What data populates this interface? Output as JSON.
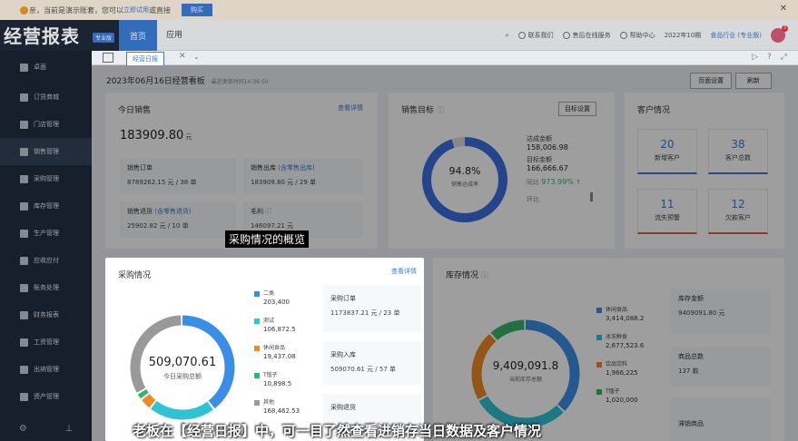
{
  "notice": {
    "text": "亲，当前是演示账套，您可以",
    "link": "立即试用",
    "text2": "或直接",
    "buy": "购买"
  },
  "header": {
    "logo": "经营报表",
    "badge": "专业版",
    "nav_home": "首页",
    "nav_app": "应用",
    "contact": "联系我们",
    "service": "售后在线服务",
    "help": "帮助中心",
    "period": "2022年10期",
    "industry": "食品行业 (专业版)",
    "avatar_badge": "3"
  },
  "sidebar": {
    "items": [
      {
        "label": "卓面"
      },
      {
        "label": "订货商城"
      },
      {
        "label": "门店管理"
      },
      {
        "label": "销售管理"
      },
      {
        "label": "采购管理"
      },
      {
        "label": "库存管理"
      },
      {
        "label": "生产管理"
      },
      {
        "label": "应收应付"
      },
      {
        "label": "账务处理"
      },
      {
        "label": "财务报表"
      },
      {
        "label": "工资管理"
      },
      {
        "label": "出纳管理"
      },
      {
        "label": "资产管理"
      }
    ]
  },
  "tabs": {
    "active": "经营日报"
  },
  "board": {
    "title": "2023年06月16日经营看板",
    "updated": "最近更新时间14:36:50",
    "config_btn": "页面设置",
    "refresh_btn": "刷新"
  },
  "today_sales": {
    "title": "今日销售",
    "detail_link": "查看详情",
    "total": "183909.80",
    "unit": "元",
    "boxes": [
      {
        "label": "销售订单",
        "value": "8789262.15 元 / 38 单"
      },
      {
        "label": "销售出库",
        "link": "(含零售出库)",
        "value": "183909.80 元 / 29 单"
      },
      {
        "label": "销售退货",
        "link": "(含零售退货)",
        "value": "25902.82 元 / 10 单"
      },
      {
        "label": "毛利",
        "value": "146097.21 元"
      }
    ]
  },
  "sales_target": {
    "title": "销售目标",
    "set_btn": "目标设置",
    "percent": "94.8%",
    "center_label": "销售达成率",
    "achieved_label": "达成金额",
    "achieved": "158,006.98",
    "target_label": "目标金额",
    "target": "166,666.67",
    "yoy_label": "同比",
    "yoy": "973.99%",
    "mom_label": "环比"
  },
  "customers": {
    "title": "客户情况",
    "boxes": [
      {
        "n": "20",
        "label": "新增客户"
      },
      {
        "n": "38",
        "label": "客户总数"
      },
      {
        "n": "11",
        "label": "流失预警"
      },
      {
        "n": "12",
        "label": "欠款客户"
      }
    ]
  },
  "purchase": {
    "title": "采购情况",
    "detail_link": "查看详情",
    "total": "509,070.61",
    "center_label": "今日采购总额",
    "legend": [
      {
        "name": "二类",
        "value": "203,400",
        "color": "#3a8ee6"
      },
      {
        "name": "测试",
        "value": "106,872.5",
        "color": "#2ec4d6"
      },
      {
        "name": "休闲食品",
        "value": "19,437.08",
        "color": "#f08a24"
      },
      {
        "name": "T恤子",
        "value": "10,898.5",
        "color": "#35b56a"
      },
      {
        "name": "其他",
        "value": "168,462.53",
        "color": "#999999"
      }
    ],
    "boxes": [
      {
        "label": "采购订单",
        "value": "1173837.21 元 / 23 单"
      },
      {
        "label": "采购入库",
        "value": "509070.61 元 / 57 单"
      },
      {
        "label": "采购退货",
        "value": ""
      }
    ]
  },
  "inventory": {
    "title": "库存情况",
    "total": "9,409,091.8",
    "center_label": "当前库存总额",
    "legend": [
      {
        "name": "休闲食品",
        "value": "3,414,088.2",
        "color": "#3a8ee6"
      },
      {
        "name": "冰冻鲜食",
        "value": "2,677,523.6",
        "color": "#2ec4d6"
      },
      {
        "name": "饮品饮料",
        "value": "1,966,225",
        "color": "#f08a24"
      },
      {
        "name": "T恤子",
        "value": "1,020,000",
        "color": "#35b56a"
      }
    ],
    "stock_amount_label": "库存金额",
    "stock_amount": "9409091.80 元",
    "goods_total_label": "商品总数",
    "goods_total": "137 款",
    "slow_label": "滞销商品"
  },
  "captions": {
    "mid": "采购情况的概览",
    "bottom": "老板在【经营日报】中，可一目了然查看进销存当日数据及客户情况"
  }
}
